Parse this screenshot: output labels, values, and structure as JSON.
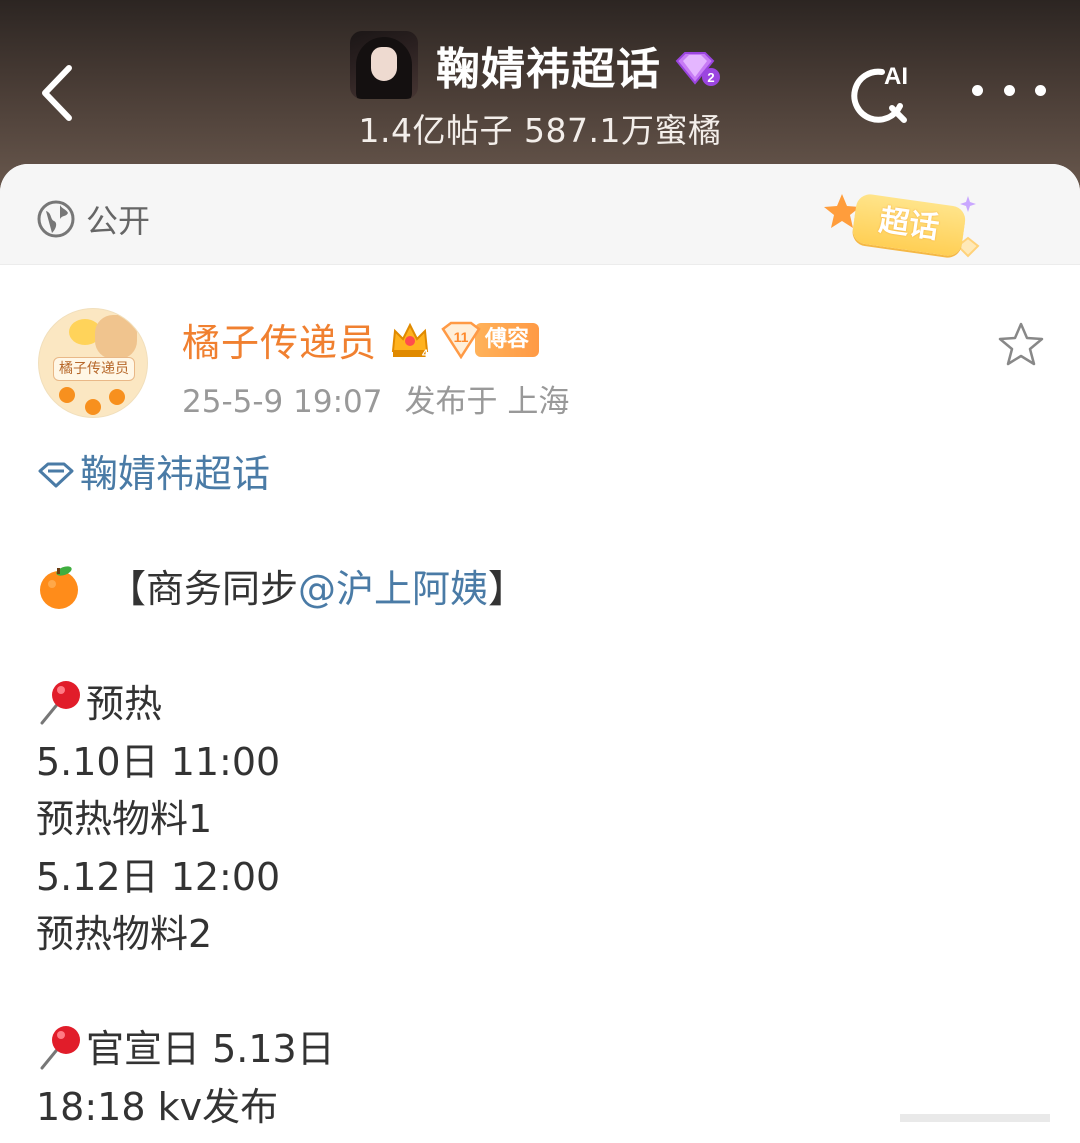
{
  "header": {
    "back_label": "",
    "topic_title": "鞠婧祎超话",
    "level_badge_number": "2",
    "stats": "1.4亿帖子 587.1万蜜橘",
    "search_ai_label": "AI"
  },
  "visibility": {
    "label": "公开",
    "sticker_text": "超话"
  },
  "post": {
    "author_name": "橘子传递员",
    "avatar_label": "橘子传递员",
    "crown_level": "4",
    "fan_badge_level": "11",
    "fan_badge_name": "傅容",
    "timestamp": "25-5-9 19:07",
    "source": "发布于 上海",
    "topic_link": "鞠婧祎超话",
    "line_business_prefix": "【商务同步",
    "mention": "@沪上阿姨",
    "line_business_suffix": "】",
    "section1_title": "预热",
    "s1_line1": "5.10日 11:00",
    "s1_line2": "预热物料1",
    "s1_line3": "5.12日 12:00",
    "s1_line4": "预热物料2",
    "section2_title": "官宣日 5.13日",
    "s2_line1": "18:18 kv发布"
  },
  "icons": {
    "back": "chevron-left-icon",
    "search_ai": "ai-search-icon",
    "more": "more-dots-icon",
    "globe": "globe-icon",
    "star": "star-outline-icon",
    "orange": "orange-emoji",
    "pin": "pushpin-emoji"
  },
  "colors": {
    "author": "#f08030",
    "link": "#4a7ba6",
    "badge_purple": "#b35cf0"
  }
}
